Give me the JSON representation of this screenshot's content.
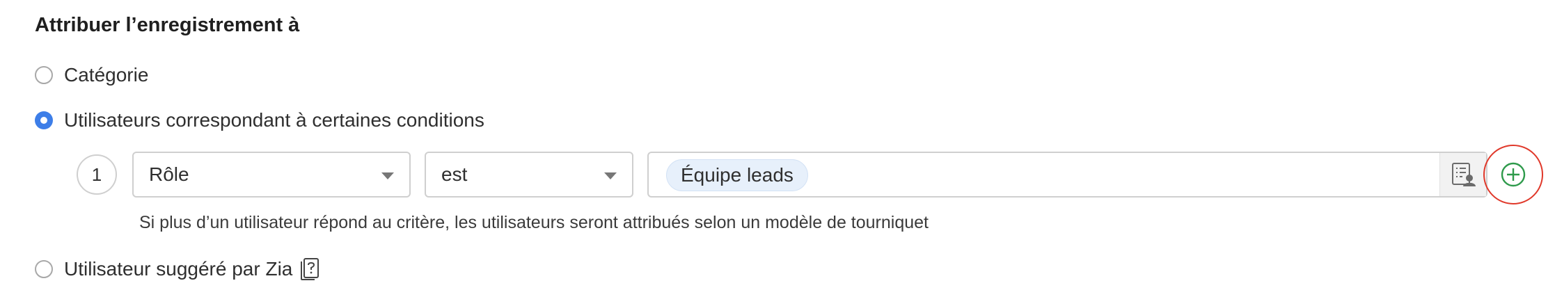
{
  "title": "Attribuer l’enregistrement à",
  "options": {
    "category": "Catégorie",
    "conditions": "Utilisateurs correspondant à certaines conditions",
    "zia": "Utilisateur suggéré par Zia"
  },
  "selected_option": "conditions",
  "condition_row": {
    "number": "1",
    "field": "Rôle",
    "operator": "est",
    "value_chip": "Équipe leads"
  },
  "hint": "Si plus d’un utilisateur répond au critère, les utilisateurs seront attribués selon un modèle de tourniquet",
  "icons": {
    "lookup": "user-list-icon",
    "add": "plus-circle-icon",
    "zia": "help-book-icon",
    "dropdown": "caret-down-icon"
  },
  "colors": {
    "radio_selected": "#3d7ee8",
    "add_icon": "#2e9a4b",
    "highlight_ring": "#e0382a",
    "chip_bg": "#e7f0fb"
  }
}
